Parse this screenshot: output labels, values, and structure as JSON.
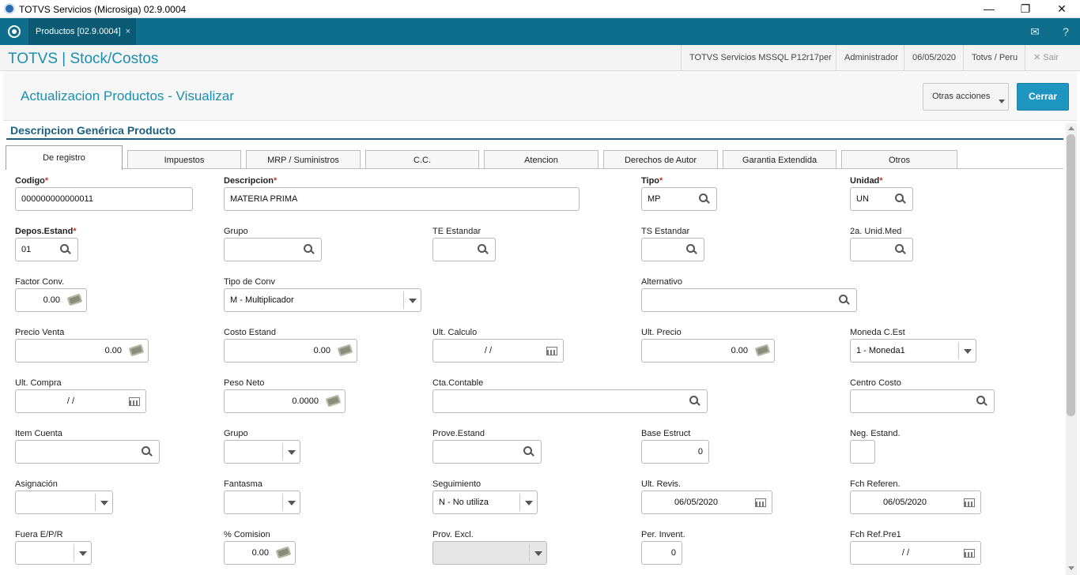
{
  "window": {
    "title": "TOTVS Servicios (Microsiga) 02.9.0004",
    "minimize": "—",
    "restore": "❐",
    "close": "✕"
  },
  "tabbar": {
    "tab_label": "Productos [02.9.0004]",
    "tab_close": "×"
  },
  "header": {
    "app_title": "TOTVS | Stock/Costos",
    "env": "TOTVS Servicios MSSQL P12r17per",
    "user": "Administrador",
    "date": "06/05/2020",
    "branch": "Totvs / Peru",
    "exit_icon": "✕",
    "exit": "Sair"
  },
  "page": {
    "title": "Actualizacion Productos - Visualizar",
    "otras_acciones": "Otras acciones",
    "cerrar": "Cerrar"
  },
  "section": {
    "title": "Descripcion Genérica Producto"
  },
  "folder_tabs": [
    "De registro",
    "Impuestos",
    "MRP / Suministros",
    "C.C.",
    "Atencion",
    "Derechos de Autor",
    "Garantia Extendida",
    "Otros"
  ],
  "fields": {
    "codigo": {
      "label": "Codigo",
      "value": "000000000000011"
    },
    "descripcion": {
      "label": "Descripcion",
      "value": "MATERIA PRIMA"
    },
    "tipo": {
      "label": "Tipo",
      "value": "MP"
    },
    "unidad": {
      "label": "Unidad",
      "value": "UN"
    },
    "depos_estand": {
      "label": "Depos.Estand",
      "value": "01"
    },
    "grupo": {
      "label": "Grupo",
      "value": ""
    },
    "te_estandar": {
      "label": "TE Estandar",
      "value": ""
    },
    "ts_estandar": {
      "label": "TS Estandar",
      "value": ""
    },
    "unid_med2": {
      "label": "2a. Unid.Med",
      "value": ""
    },
    "factor_conv": {
      "label": "Factor Conv.",
      "value": "0.00"
    },
    "tipo_conv": {
      "label": "Tipo de Conv",
      "value": "M - Multiplicador"
    },
    "alternativo": {
      "label": "Alternativo",
      "value": ""
    },
    "precio_venta": {
      "label": "Precio Venta",
      "value": "0.00"
    },
    "costo_estand": {
      "label": "Costo Estand",
      "value": "0.00"
    },
    "ult_calculo": {
      "label": "Ult. Calculo",
      "value": "/ /"
    },
    "ult_precio": {
      "label": "Ult. Precio",
      "value": "0.00"
    },
    "moneda_cest": {
      "label": "Moneda C.Est",
      "value": "1 - Moneda1"
    },
    "ult_compra": {
      "label": "Ult. Compra",
      "value": "/ /"
    },
    "peso_neto": {
      "label": "Peso Neto",
      "value": "0.0000"
    },
    "cta_contable": {
      "label": "Cta.Contable",
      "value": ""
    },
    "centro_costo": {
      "label": "Centro Costo",
      "value": ""
    },
    "item_cuenta": {
      "label": "Item Cuenta",
      "value": ""
    },
    "grupo2": {
      "label": "Grupo",
      "value": ""
    },
    "prove_estand": {
      "label": "Prove.Estand",
      "value": ""
    },
    "base_estruct": {
      "label": "Base Estruct",
      "value": "0"
    },
    "neg_estand": {
      "label": "Neg. Estand.",
      "value": ""
    },
    "asignacion": {
      "label": "Asignación",
      "value": ""
    },
    "fantasma": {
      "label": "Fantasma",
      "value": ""
    },
    "seguimiento": {
      "label": "Seguimiento",
      "value": "N - No utiliza"
    },
    "ult_revis": {
      "label": "Ult. Revis.",
      "value": "06/05/2020"
    },
    "fch_referen": {
      "label": "Fch Referen.",
      "value": "06/05/2020"
    },
    "fuera_epr": {
      "label": "Fuera E/P/R",
      "value": ""
    },
    "comision": {
      "label": "% Comision",
      "value": "0.00"
    },
    "prov_excl": {
      "label": "Prov. Excl.",
      "value": ""
    },
    "per_invent": {
      "label": "Per. Invent.",
      "value": "0"
    },
    "fch_ref_pre1": {
      "label": "Fch Ref.Pre1",
      "value": "/ /"
    }
  }
}
